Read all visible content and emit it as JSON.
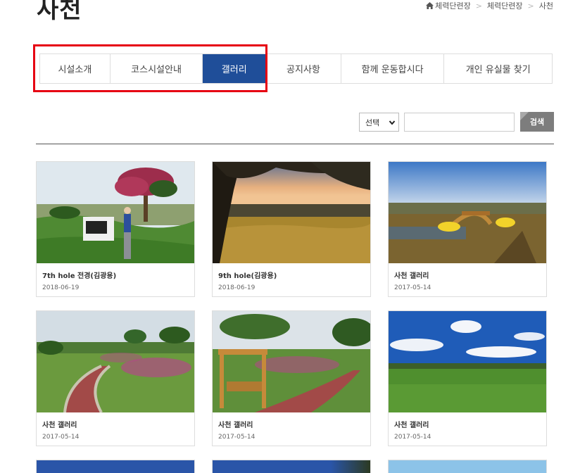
{
  "page": {
    "title": "사천"
  },
  "breadcrumb": {
    "items": [
      "체력단련장",
      "체력단련장",
      "사천"
    ]
  },
  "tabs": [
    {
      "label": "시설소개",
      "active": false
    },
    {
      "label": "코스시설안내",
      "active": false
    },
    {
      "label": "갤러리",
      "active": true
    },
    {
      "label": "공지사항",
      "active": false
    },
    {
      "label": "함께 운동합시다",
      "active": false
    },
    {
      "label": "개인 유실물 찾기",
      "active": false
    }
  ],
  "search": {
    "select_value": "선택",
    "input_value": "",
    "button_label": "검색"
  },
  "gallery": [
    {
      "title": "7th hole 전경(김광용)",
      "date": "2018-06-19"
    },
    {
      "title": "9th hole(김광용)",
      "date": "2018-06-19"
    },
    {
      "title": "사천 갤러리",
      "date": "2017-05-14"
    },
    {
      "title": "사천 갤러리",
      "date": "2017-05-14"
    },
    {
      "title": "사천 갤러리",
      "date": "2017-05-14"
    },
    {
      "title": "사천 갤러리",
      "date": "2017-05-14"
    }
  ],
  "colors": {
    "active_tab": "#1f4e99",
    "highlight_box": "#e60012",
    "search_button": "#7d7d7d"
  }
}
